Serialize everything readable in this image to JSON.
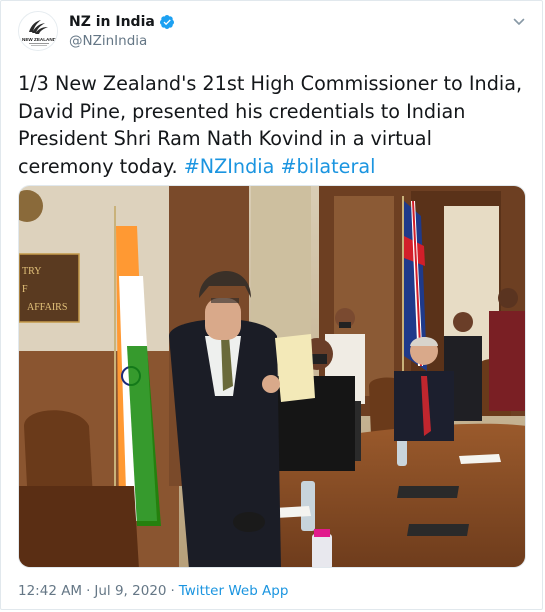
{
  "header": {
    "display_name": "NZ in India",
    "handle": "@NZinIndia",
    "avatar_text": "NEW ZEALAND",
    "verified": true,
    "menu_icon": "chevron-down-icon"
  },
  "tweet": {
    "text_plain": "1/3 New Zealand's 21st High Commissioner to India, David Pine, presented his credentials to Indian President Shri Ram Nath Kovind in a virtual ceremony today.",
    "hashtags": [
      "#NZIndia",
      "#bilateral"
    ]
  },
  "photo": {
    "sign_line1": "TRY",
    "sign_line2": "F",
    "sign_line3": "AFFAIRS"
  },
  "footer": {
    "time": "12:42 AM",
    "separator": "·",
    "date": "Jul 9, 2020",
    "source": "Twitter Web App"
  },
  "colors": {
    "link": "#1b95e0",
    "text": "#14171a",
    "muted": "#657786",
    "verified_badge": "#1da1f2"
  }
}
